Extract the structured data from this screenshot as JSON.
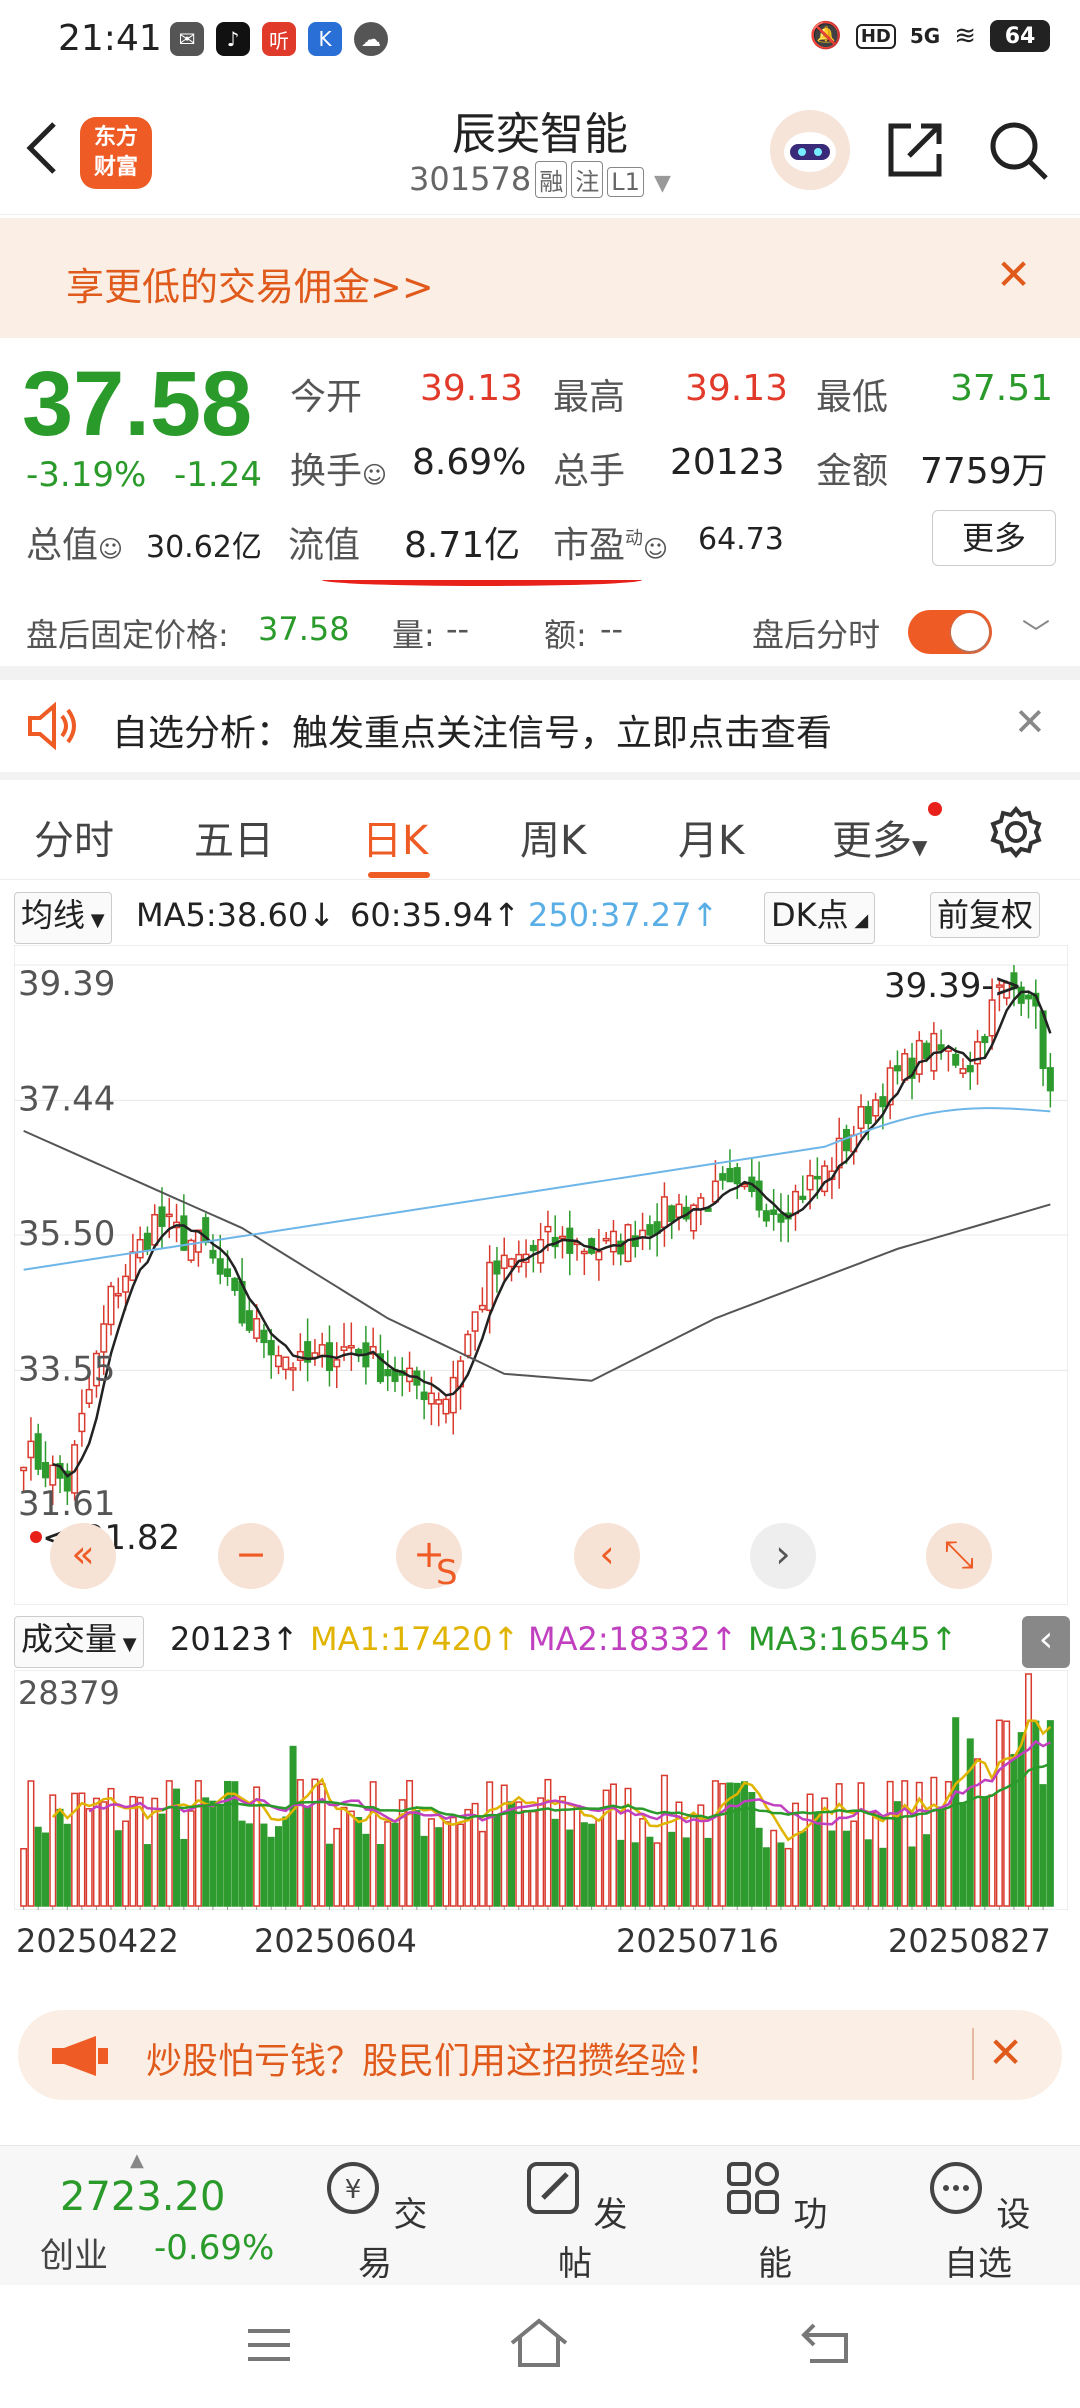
{
  "status_bar": {
    "time": "21:41",
    "network": "5G",
    "hd": "HD",
    "battery": "64"
  },
  "header": {
    "stock_name": "辰奕智能",
    "code": "301578",
    "tags": [
      "融",
      "注",
      "L1"
    ],
    "logo_lines": [
      "东方",
      "财富"
    ]
  },
  "promo": {
    "text": "享更低的交易佣金>>"
  },
  "quote": {
    "price": "37.58",
    "change_pct": "-3.19%",
    "change": "-1.24",
    "fields": [
      {
        "label": "今开",
        "value": "39.13"
      },
      {
        "label": "最高",
        "value": "39.13"
      },
      {
        "label": "最低",
        "value": "37.51"
      },
      {
        "label": "换手",
        "value": "8.69%"
      },
      {
        "label": "总手",
        "value": "20123"
      },
      {
        "label": "金额",
        "value": "7759万"
      },
      {
        "label": "总值",
        "value": "30.62亿"
      },
      {
        "label": "流值",
        "value": "8.71亿"
      },
      {
        "label": "市盈",
        "value": "64.73"
      }
    ],
    "pe_tag": "动",
    "more": "更多"
  },
  "after_hours": {
    "label": "盘后固定价格:",
    "price": "37.58",
    "vol_label": "量:",
    "vol": "--",
    "amt_label": "额:",
    "amt": "--",
    "toggle_label": "盘后分时",
    "toggle_on": true
  },
  "analysis_banner": {
    "text": "自选分析：触发重点关注信号，立即点击查看"
  },
  "tabs": {
    "items": [
      "分时",
      "五日",
      "日K",
      "周K",
      "月K",
      "更多"
    ],
    "active": "日K"
  },
  "ma_bar": {
    "dropdown": "均线",
    "ma5": "MA5:38.60",
    "ma60": "60:35.94",
    "ma250": "250:37.27",
    "dk": "DK点",
    "adjust": "前复权"
  },
  "chart_data": {
    "type": "candlestick",
    "y_ticks": [
      "39.39",
      "37.44",
      "35.50",
      "33.55",
      "31.61"
    ],
    "high_label": "39.39->",
    "low_label": "<-31.82",
    "date_labels": [
      "20250422",
      "20250604",
      "20250716",
      "20250827"
    ],
    "colors": {
      "up": "#d83a2e",
      "down": "#2e9b2e",
      "ma5": "#222222",
      "ma60": "#555555",
      "ma250": "#6fb6e8"
    }
  },
  "volume": {
    "dropdown": "成交量",
    "vol": "20123",
    "ma1": "MA1:17420",
    "ma2": "MA2:18332",
    "ma3": "MA3:16545",
    "max_label": "28379",
    "colors": {
      "ma1": "#e0b400",
      "ma2": "#c040c0",
      "ma3": "#2a9a2a"
    }
  },
  "banner3": {
    "text": "炒股怕亏钱？股民们用这招攒经验！"
  },
  "bottom_nav": {
    "index_value": "2723.20",
    "index_name": "创业",
    "index_change": "-0.69%",
    "items": [
      "交易",
      "发帖",
      "功能",
      "设自选"
    ]
  }
}
